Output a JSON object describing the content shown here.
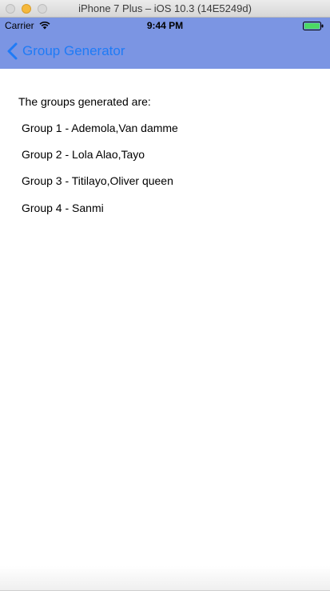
{
  "simulator": {
    "title": "iPhone 7 Plus – iOS 10.3 (14E5249d)"
  },
  "status_bar": {
    "carrier": "Carrier",
    "time": "9:44 PM"
  },
  "nav_bar": {
    "back_label": "Group Generator"
  },
  "content": {
    "heading": "The groups generated are:",
    "groups": [
      "Group 1 - Ademola,Van damme",
      "Group 2 - Lola Alao,Tayo",
      "Group 3 - Titilayo,Oliver queen",
      "Group 4 - Sanmi"
    ]
  },
  "colors": {
    "nav_background": "#7b95e3",
    "tint": "#1f7bf6",
    "battery": "#4cd964"
  }
}
